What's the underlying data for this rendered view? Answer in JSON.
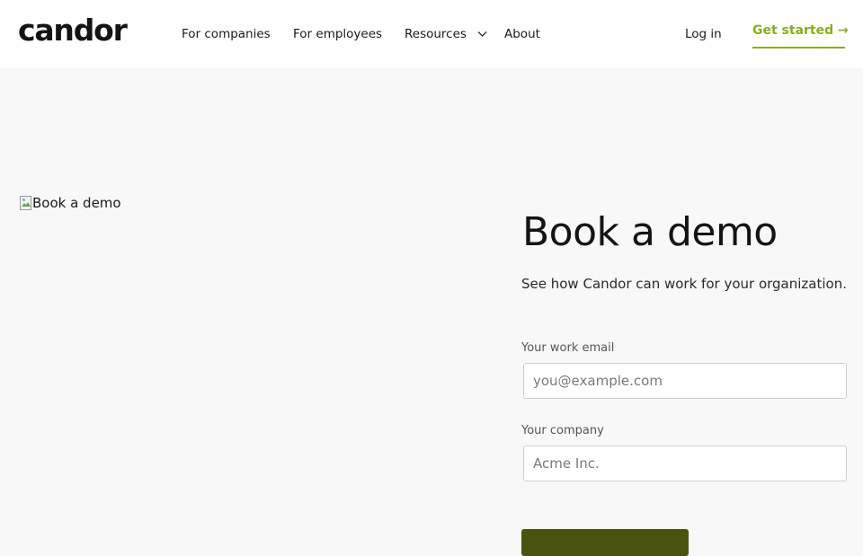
{
  "header": {
    "logo": "candor",
    "nav": [
      {
        "label": "For companies"
      },
      {
        "label": "For employees"
      },
      {
        "label": "Resources",
        "icon": "chevron-down-icon"
      },
      {
        "label": "About"
      }
    ],
    "login_label": "Log in",
    "cta_label": "Get started →",
    "accent_color": "#8aad1c"
  },
  "hero": {
    "image_alt": "Book a demo",
    "title": "Book a demo",
    "subtitle": "See how Candor can work for your organization."
  },
  "form": {
    "email": {
      "label": "Your work email",
      "placeholder": "you@example.com",
      "value": ""
    },
    "company": {
      "label": "Your company",
      "placeholder": "Acme Inc.",
      "value": ""
    },
    "submit_color": "#4a5410"
  }
}
